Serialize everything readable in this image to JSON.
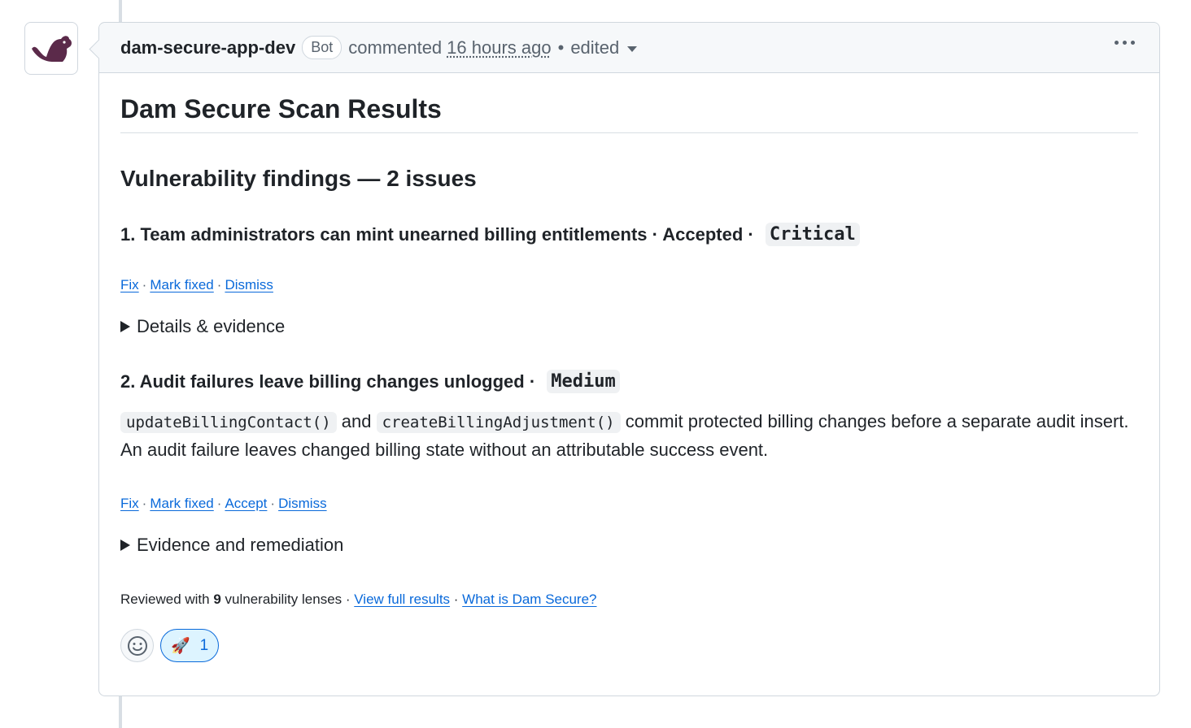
{
  "comment": {
    "author": "dam-secure-app-dev",
    "bot_label": "Bot",
    "action": "commented",
    "timestamp": "16 hours ago",
    "separator": "•",
    "edited_label": "edited"
  },
  "content": {
    "title": "Dam Secure Scan Results",
    "findings_heading": "Vulnerability findings — 2 issues",
    "findings": [
      {
        "title": "1. Team administrators can mint unearned billing entitlements · Accepted · ",
        "severity": "Critical",
        "actions": [
          "Fix",
          "Mark fixed",
          "Dismiss"
        ],
        "details_label": "Details & evidence"
      },
      {
        "title": "2. Audit failures leave billing changes unlogged · ",
        "severity": "Medium",
        "desc_code_1": "updateBillingContact()",
        "desc_and": " and ",
        "desc_code_2": "createBillingAdjustment()",
        "desc_text": " commit protected billing changes before a separate audit insert. An audit failure leaves changed billing state without an attributable success event.",
        "actions": [
          "Fix",
          "Mark fixed",
          "Accept",
          "Dismiss"
        ],
        "details_label": "Evidence and remediation"
      }
    ],
    "footer": {
      "prefix": "Reviewed with ",
      "count": "9",
      "suffix": " vulnerability lenses · ",
      "link_full": "View full results",
      "sep": " · ",
      "link_what": "What is Dam Secure?"
    }
  },
  "reactions": {
    "add_icon": "smiley-icon",
    "rocket_emoji": "🚀",
    "rocket_count": "1"
  },
  "colors": {
    "link": "#0969da",
    "avatar_brand": "#5b2a4a"
  }
}
